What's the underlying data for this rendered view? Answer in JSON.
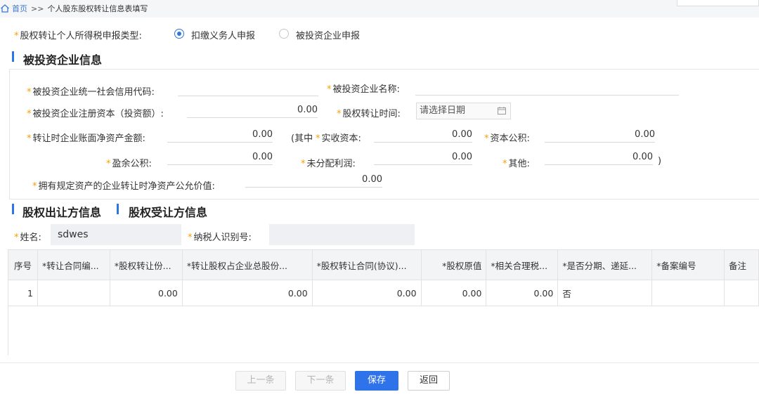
{
  "breadcrumb": {
    "home": "首页",
    "separator": ">>",
    "current": "个人股东股权转让信息表填写"
  },
  "declare_type": {
    "label": "股权转让个人所得税申报类型:",
    "options": [
      {
        "label": "扣缴义务人申报",
        "selected": true
      },
      {
        "label": "被投资企业申报",
        "selected": false
      }
    ]
  },
  "invested_section": {
    "title": "被投资企业信息",
    "credit_code_label": "被投资企业统一社会信用代码:",
    "credit_code_value": "",
    "company_name_label": "被投资企业名称:",
    "company_name_value": "",
    "registered_capital_label": "被投资企业注册资本（投资额）:",
    "registered_capital_value": "0.00",
    "transfer_time_label": "股权转让时间:",
    "transfer_time_placeholder": "请选择日期",
    "net_assets_label": "转让时企业账面净资产金额:",
    "net_assets_value": "0.00",
    "among_prefix": "(其中",
    "paid_in_label": "实收资本:",
    "paid_in_value": "0.00",
    "capital_reserve_label": "资本公积:",
    "capital_reserve_value": "0.00",
    "surplus_reserve_label": "盈余公积:",
    "surplus_reserve_value": "0.00",
    "undistributed_label": "未分配利润:",
    "undistributed_value": "0.00",
    "other_label": "其他:",
    "other_value": "0.00",
    "close_paren": ")",
    "fair_value_label": "拥有规定资产的企业转让时净资产公允价值:",
    "fair_value_value": "0.00"
  },
  "tabs": {
    "transferor": "股权出让方信息",
    "transferee": "股权受让方信息"
  },
  "person": {
    "name_label": "姓名:",
    "name_value": "sdwes",
    "tax_id_label": "纳税人识别号:",
    "tax_id_value": ""
  },
  "table": {
    "headers": [
      "序号",
      "*转让合同编...",
      "*股权转让份...",
      "*转让股权占企业总股份...",
      "*股权转让合同(协议)...",
      "*股权原值",
      "*相关合理税...",
      "*是否分期、递延...",
      "*备案编号",
      "备注"
    ],
    "rows": [
      [
        "1",
        "",
        "0.00",
        "0.00",
        "0.00",
        "0.00",
        "0.00",
        "否",
        "",
        ""
      ]
    ]
  },
  "buttons": {
    "prev": "上一条",
    "next": "下一条",
    "save": "保存",
    "back": "返回"
  },
  "colors": {
    "accent": "#2f73ea",
    "required": "#f5a000",
    "link": "#3a78d4"
  }
}
